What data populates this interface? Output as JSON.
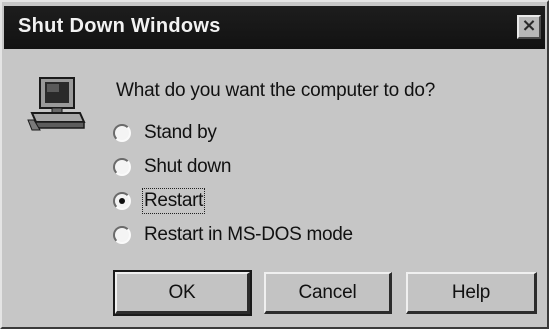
{
  "window": {
    "title": "Shut Down Windows",
    "close_symbol": "×"
  },
  "icon": {
    "name": "computer-icon"
  },
  "prompt": "What do you want the computer to do?",
  "options": [
    {
      "label": "Stand by",
      "mnemonic_index": 1,
      "selected": false
    },
    {
      "label": "Shut down",
      "mnemonic_index": 1,
      "selected": false
    },
    {
      "label": "Restart",
      "mnemonic_index": 0,
      "selected": true
    },
    {
      "label": "Restart in MS-DOS mode",
      "mnemonic_index": 11,
      "selected": false
    }
  ],
  "buttons": {
    "ok": "OK",
    "cancel": "Cancel",
    "help": "Help"
  }
}
